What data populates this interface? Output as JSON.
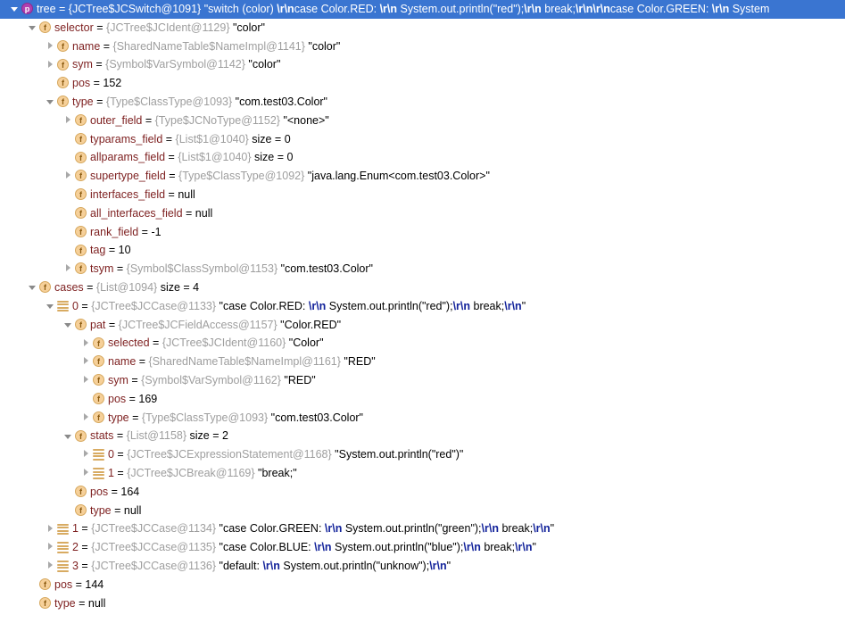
{
  "theme": {
    "selection_bg": "#3a75d1",
    "selection_fg": "#ffffff",
    "field_name_color": "#7d1f1f",
    "reference_color": "#9e9e9e",
    "escape_color": "#12229a",
    "field_badge_color": "#f6d099",
    "param_badge_color": "#b03fb0",
    "list_icon_color": "#d8ab62",
    "background": "#ffffff"
  },
  "icons": {
    "expanded": "triangle-down-icon",
    "collapsed": "triangle-right-icon",
    "field": "field-badge-icon",
    "param": "parameter-badge-icon",
    "list": "list-element-icon"
  },
  "rows": [
    {
      "depth": 0,
      "twisty": "expanded",
      "icon": "param",
      "selected": true,
      "name": "tree",
      "ref": "{JCTree$JCSwitch@1091}",
      "parts": [
        {
          "t": "str",
          "v": "\"switch (color) "
        },
        {
          "t": "esc",
          "v": "\\r\\n"
        },
        {
          "t": "str",
          "v": "case Color.RED: "
        },
        {
          "t": "esc",
          "v": "\\r\\n"
        },
        {
          "t": "str",
          "v": "    System.out.println(\"red\");"
        },
        {
          "t": "esc",
          "v": "\\r\\n"
        },
        {
          "t": "str",
          "v": "    break;"
        },
        {
          "t": "esc",
          "v": "\\r\\n\\r\\n"
        },
        {
          "t": "str",
          "v": "case Color.GREEN: "
        },
        {
          "t": "esc",
          "v": "\\r\\n"
        },
        {
          "t": "str",
          "v": "    System"
        }
      ]
    },
    {
      "depth": 1,
      "twisty": "expanded",
      "icon": "field",
      "selected": false,
      "name": "selector",
      "ref": "{JCTree$JCIdent@1129}",
      "parts": [
        {
          "t": "str",
          "v": "\"color\""
        }
      ]
    },
    {
      "depth": 2,
      "twisty": "collapsed",
      "icon": "field",
      "selected": false,
      "name": "name",
      "ref": "{SharedNameTable$NameImpl@1141}",
      "parts": [
        {
          "t": "str",
          "v": "\"color\""
        }
      ]
    },
    {
      "depth": 2,
      "twisty": "collapsed",
      "icon": "field",
      "selected": false,
      "name": "sym",
      "ref": "{Symbol$VarSymbol@1142}",
      "parts": [
        {
          "t": "str",
          "v": "\"color\""
        }
      ]
    },
    {
      "depth": 2,
      "twisty": "none",
      "icon": "field",
      "selected": false,
      "name": "pos",
      "ref": "",
      "parts": [
        {
          "t": "val",
          "v": "152"
        }
      ]
    },
    {
      "depth": 2,
      "twisty": "expanded",
      "icon": "field",
      "selected": false,
      "name": "type",
      "ref": "{Type$ClassType@1093}",
      "parts": [
        {
          "t": "str",
          "v": "\"com.test03.Color\""
        }
      ]
    },
    {
      "depth": 3,
      "twisty": "collapsed",
      "icon": "field",
      "selected": false,
      "name": "outer_field",
      "ref": "{Type$JCNoType@1152}",
      "parts": [
        {
          "t": "str",
          "v": "\"<none>\""
        }
      ]
    },
    {
      "depth": 3,
      "twisty": "none",
      "icon": "field",
      "selected": false,
      "name": "typarams_field",
      "ref": "{List$1@1040}",
      "parts": [
        {
          "t": "val",
          "v": "size = 0"
        }
      ]
    },
    {
      "depth": 3,
      "twisty": "none",
      "icon": "field",
      "selected": false,
      "name": "allparams_field",
      "ref": "{List$1@1040}",
      "parts": [
        {
          "t": "val",
          "v": "size = 0"
        }
      ]
    },
    {
      "depth": 3,
      "twisty": "collapsed",
      "icon": "field",
      "selected": false,
      "name": "supertype_field",
      "ref": "{Type$ClassType@1092}",
      "parts": [
        {
          "t": "str",
          "v": "\"java.lang.Enum<com.test03.Color>\""
        }
      ]
    },
    {
      "depth": 3,
      "twisty": "none",
      "icon": "field",
      "selected": false,
      "name": "interfaces_field",
      "ref": "",
      "parts": [
        {
          "t": "val",
          "v": "null"
        }
      ]
    },
    {
      "depth": 3,
      "twisty": "none",
      "icon": "field",
      "selected": false,
      "name": "all_interfaces_field",
      "ref": "",
      "parts": [
        {
          "t": "val",
          "v": "null"
        }
      ]
    },
    {
      "depth": 3,
      "twisty": "none",
      "icon": "field",
      "selected": false,
      "name": "rank_field",
      "ref": "",
      "parts": [
        {
          "t": "val",
          "v": "-1"
        }
      ]
    },
    {
      "depth": 3,
      "twisty": "none",
      "icon": "field",
      "selected": false,
      "name": "tag",
      "ref": "",
      "parts": [
        {
          "t": "val",
          "v": "10"
        }
      ]
    },
    {
      "depth": 3,
      "twisty": "collapsed",
      "icon": "field",
      "selected": false,
      "name": "tsym",
      "ref": "{Symbol$ClassSymbol@1153}",
      "parts": [
        {
          "t": "str",
          "v": "\"com.test03.Color\""
        }
      ]
    },
    {
      "depth": 1,
      "twisty": "expanded",
      "icon": "field",
      "selected": false,
      "name": "cases",
      "ref": "{List@1094}",
      "parts": [
        {
          "t": "val",
          "v": "size = 4"
        }
      ]
    },
    {
      "depth": 2,
      "twisty": "expanded",
      "icon": "list",
      "selected": false,
      "name": "0",
      "ref": "{JCTree$JCCase@1133}",
      "parts": [
        {
          "t": "str",
          "v": "\"case Color.RED: "
        },
        {
          "t": "esc",
          "v": "\\r\\n"
        },
        {
          "t": "str",
          "v": "    System.out.println(\"red\");"
        },
        {
          "t": "esc",
          "v": "\\r\\n"
        },
        {
          "t": "str",
          "v": "    break;"
        },
        {
          "t": "esc",
          "v": "\\r\\n"
        },
        {
          "t": "str",
          "v": "\""
        }
      ]
    },
    {
      "depth": 3,
      "twisty": "expanded",
      "icon": "field",
      "selected": false,
      "name": "pat",
      "ref": "{JCTree$JCFieldAccess@1157}",
      "parts": [
        {
          "t": "str",
          "v": "\"Color.RED\""
        }
      ]
    },
    {
      "depth": 4,
      "twisty": "collapsed",
      "icon": "field",
      "selected": false,
      "name": "selected",
      "ref": "{JCTree$JCIdent@1160}",
      "parts": [
        {
          "t": "str",
          "v": "\"Color\""
        }
      ]
    },
    {
      "depth": 4,
      "twisty": "collapsed",
      "icon": "field",
      "selected": false,
      "name": "name",
      "ref": "{SharedNameTable$NameImpl@1161}",
      "parts": [
        {
          "t": "str",
          "v": "\"RED\""
        }
      ]
    },
    {
      "depth": 4,
      "twisty": "collapsed",
      "icon": "field",
      "selected": false,
      "name": "sym",
      "ref": "{Symbol$VarSymbol@1162}",
      "parts": [
        {
          "t": "str",
          "v": "\"RED\""
        }
      ]
    },
    {
      "depth": 4,
      "twisty": "none",
      "icon": "field",
      "selected": false,
      "name": "pos",
      "ref": "",
      "parts": [
        {
          "t": "val",
          "v": "169"
        }
      ]
    },
    {
      "depth": 4,
      "twisty": "collapsed",
      "icon": "field",
      "selected": false,
      "name": "type",
      "ref": "{Type$ClassType@1093}",
      "parts": [
        {
          "t": "str",
          "v": "\"com.test03.Color\""
        }
      ]
    },
    {
      "depth": 3,
      "twisty": "expanded",
      "icon": "field",
      "selected": false,
      "name": "stats",
      "ref": "{List@1158}",
      "parts": [
        {
          "t": "val",
          "v": "size = 2"
        }
      ]
    },
    {
      "depth": 4,
      "twisty": "collapsed",
      "icon": "list",
      "selected": false,
      "name": "0",
      "ref": "{JCTree$JCExpressionStatement@1168}",
      "parts": [
        {
          "t": "str",
          "v": "\"System.out.println(\"red\")\""
        }
      ]
    },
    {
      "depth": 4,
      "twisty": "collapsed",
      "icon": "list",
      "selected": false,
      "name": "1",
      "ref": "{JCTree$JCBreak@1169}",
      "parts": [
        {
          "t": "str",
          "v": "\"break;\""
        }
      ]
    },
    {
      "depth": 3,
      "twisty": "none",
      "icon": "field",
      "selected": false,
      "name": "pos",
      "ref": "",
      "parts": [
        {
          "t": "val",
          "v": "164"
        }
      ]
    },
    {
      "depth": 3,
      "twisty": "none",
      "icon": "field",
      "selected": false,
      "name": "type",
      "ref": "",
      "parts": [
        {
          "t": "val",
          "v": "null"
        }
      ]
    },
    {
      "depth": 2,
      "twisty": "collapsed",
      "icon": "list",
      "selected": false,
      "name": "1",
      "ref": "{JCTree$JCCase@1134}",
      "parts": [
        {
          "t": "str",
          "v": "\"case Color.GREEN: "
        },
        {
          "t": "esc",
          "v": "\\r\\n"
        },
        {
          "t": "str",
          "v": "    System.out.println(\"green\");"
        },
        {
          "t": "esc",
          "v": "\\r\\n"
        },
        {
          "t": "str",
          "v": "    break;"
        },
        {
          "t": "esc",
          "v": "\\r\\n"
        },
        {
          "t": "str",
          "v": "\""
        }
      ]
    },
    {
      "depth": 2,
      "twisty": "collapsed",
      "icon": "list",
      "selected": false,
      "name": "2",
      "ref": "{JCTree$JCCase@1135}",
      "parts": [
        {
          "t": "str",
          "v": "\"case Color.BLUE: "
        },
        {
          "t": "esc",
          "v": "\\r\\n"
        },
        {
          "t": "str",
          "v": "    System.out.println(\"blue\");"
        },
        {
          "t": "esc",
          "v": "\\r\\n"
        },
        {
          "t": "str",
          "v": "    break;"
        },
        {
          "t": "esc",
          "v": "\\r\\n"
        },
        {
          "t": "str",
          "v": "\""
        }
      ]
    },
    {
      "depth": 2,
      "twisty": "collapsed",
      "icon": "list",
      "selected": false,
      "name": "3",
      "ref": "{JCTree$JCCase@1136}",
      "parts": [
        {
          "t": "str",
          "v": "\"default: "
        },
        {
          "t": "esc",
          "v": "\\r\\n"
        },
        {
          "t": "str",
          "v": "    System.out.println(\"unknow\");"
        },
        {
          "t": "esc",
          "v": "\\r\\n"
        },
        {
          "t": "str",
          "v": "\""
        }
      ]
    },
    {
      "depth": 1,
      "twisty": "none",
      "icon": "field",
      "selected": false,
      "name": "pos",
      "ref": "",
      "parts": [
        {
          "t": "val",
          "v": "144"
        }
      ]
    },
    {
      "depth": 1,
      "twisty": "none",
      "icon": "field",
      "selected": false,
      "name": "type",
      "ref": "",
      "parts": [
        {
          "t": "val",
          "v": "null"
        }
      ]
    }
  ]
}
